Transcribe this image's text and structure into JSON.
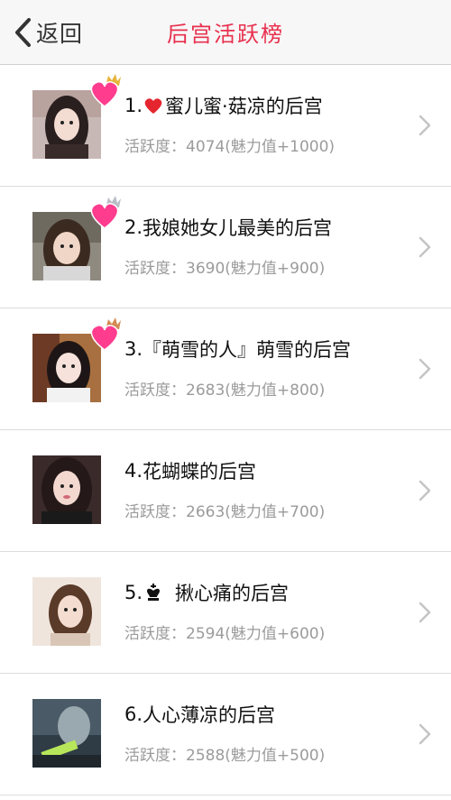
{
  "header": {
    "back_label": "返回",
    "title": "后宫活跃榜"
  },
  "colors": {
    "accent": "#e8304e",
    "heart": "#ff3c8e",
    "text_primary": "#111111",
    "text_secondary": "#9b9b9b"
  },
  "stats_prefix": "活跃度：",
  "items": [
    {
      "rank": "1.",
      "name": "蜜儿蜜·菇凉的后宫",
      "inline_icon": "red-heart-icon",
      "badge": "crown-heart-badge",
      "score": "4074",
      "bonus": "(魅力值+1000)"
    },
    {
      "rank": "2.",
      "name": "我娘她女儿最美的后宫",
      "inline_icon": "",
      "badge": "crown-heart-badge",
      "score": "3690",
      "bonus": "(魅力值+900)"
    },
    {
      "rank": "3.",
      "name": "『萌雪的人』萌雪的后宫",
      "inline_icon": "",
      "badge": "crown-heart-badge",
      "score": "2683",
      "bonus": "(魅力值+800)"
    },
    {
      "rank": "4.",
      "name": "花蝴蝶的后宫",
      "inline_icon": "",
      "badge": "",
      "score": "2663",
      "bonus": "(魅力值+700)"
    },
    {
      "rank": "5.",
      "name": "揪心痛的后宫",
      "inline_icon": "chess-king-icon",
      "badge": "",
      "score": "2594",
      "bonus": "(魅力值+600)"
    },
    {
      "rank": "6.",
      "name": "人心薄凉的后宫",
      "inline_icon": "",
      "badge": "",
      "score": "2588",
      "bonus": "(魅力值+500)"
    }
  ]
}
